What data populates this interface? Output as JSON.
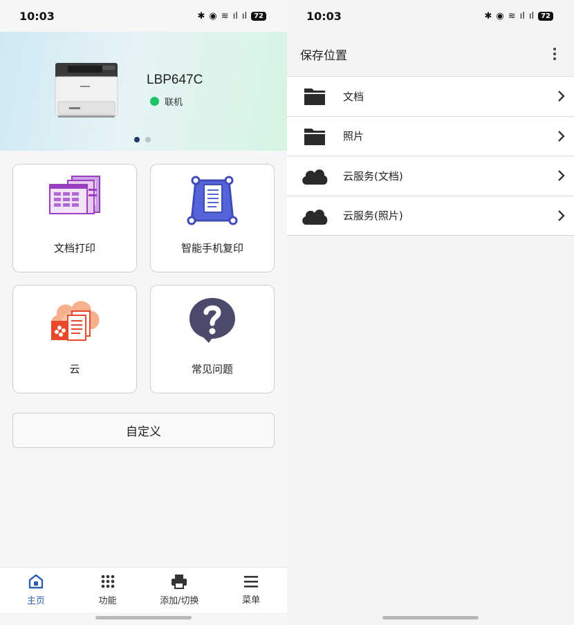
{
  "left": {
    "status_bar": {
      "time": "10:03",
      "battery": "72"
    },
    "printer": {
      "model": "LBP647C",
      "status": "联机"
    },
    "tiles": {
      "doc_print": "文档打印",
      "smart_copy": "智能手机复印",
      "cloud": "云",
      "faq": "常见问题"
    },
    "customize": "自定义",
    "bottom_nav": {
      "home": "主页",
      "functions": "功能",
      "add_switch": "添加/切换",
      "menu": "菜单"
    }
  },
  "right": {
    "status_bar": {
      "time": "10:03",
      "battery": "72"
    },
    "title": "保存位置",
    "locations": [
      {
        "label": "文档",
        "icon": "folder-icon"
      },
      {
        "label": "照片",
        "icon": "folder-icon"
      },
      {
        "label": "云服务(文档)",
        "icon": "cloud-icon"
      },
      {
        "label": "云服务(照片)",
        "icon": "cloud-icon"
      }
    ]
  },
  "colors": {
    "accent_blue": "#2c5fb0",
    "online_green": "#1bc464",
    "doc_purple": "#9b3fc1",
    "copy_blue": "#5564d8",
    "cloud_orange": "#f27b45",
    "faq_slate": "#4a4a6a"
  }
}
